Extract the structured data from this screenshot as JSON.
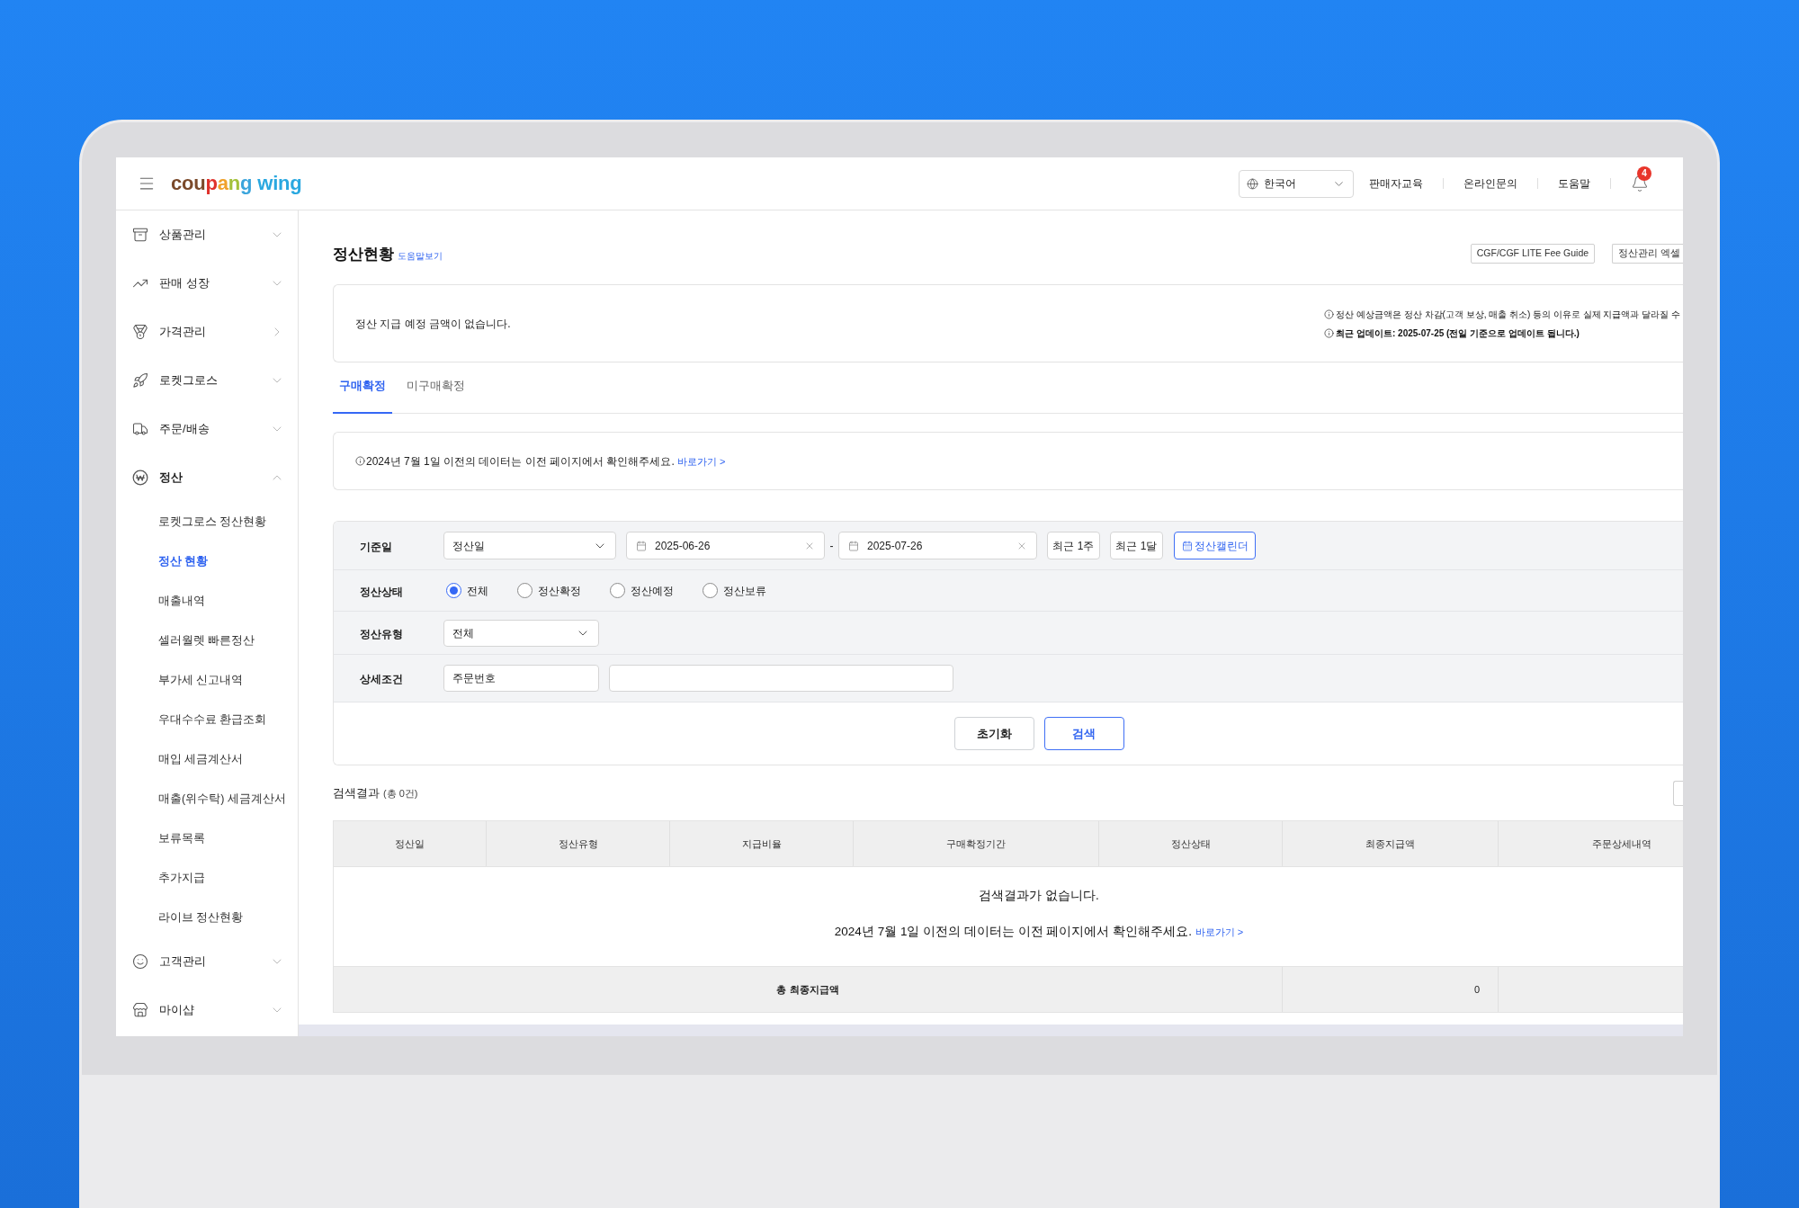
{
  "header": {
    "logo": {
      "parts": [
        {
          "text": "cou",
          "color": "#7b4a2b"
        },
        {
          "text": "p",
          "color": "#e0322c"
        },
        {
          "text": "a",
          "color": "#f0a12a"
        },
        {
          "text": "n",
          "color": "#a3c13a"
        },
        {
          "text": "g",
          "color": "#3ba5dc"
        },
        {
          "text": " wing",
          "color": "#2aa8e0"
        }
      ]
    },
    "language": "한국어",
    "links": [
      "판매자교육",
      "온라인문의",
      "도움말"
    ],
    "notification_count": "4"
  },
  "sidebar": {
    "items": [
      {
        "label": "상품관리",
        "kind": "group",
        "expanded": false
      },
      {
        "label": "판매 성장",
        "kind": "group",
        "expanded": false
      },
      {
        "label": "가격관리",
        "kind": "link"
      },
      {
        "label": "로켓그로스",
        "kind": "group",
        "expanded": false
      },
      {
        "label": "주문/배송",
        "kind": "group",
        "expanded": false
      },
      {
        "label": "정산",
        "kind": "group",
        "expanded": true,
        "children": [
          {
            "label": "로켓그로스 정산현황",
            "selected": false
          },
          {
            "label": "정산 현황",
            "selected": true
          },
          {
            "label": "매출내역",
            "selected": false
          },
          {
            "label": "셀러월렛 빠른정산",
            "selected": false
          },
          {
            "label": "부가세 신고내역",
            "selected": false
          },
          {
            "label": "우대수수료 환급조회",
            "selected": false
          },
          {
            "label": "매입 세금계산서",
            "selected": false
          },
          {
            "label": "매출(위수탁) 세금계산서",
            "selected": false
          },
          {
            "label": "보류목록",
            "selected": false
          },
          {
            "label": "추가지급",
            "selected": false
          },
          {
            "label": "라이브 정산현황",
            "selected": false
          }
        ]
      },
      {
        "label": "고객관리",
        "kind": "group",
        "expanded": false
      },
      {
        "label": "마이샵",
        "kind": "group",
        "expanded": false
      }
    ]
  },
  "page": {
    "title": "정산현황",
    "help_link": "도움말보기",
    "buttons": [
      "CGF/CGF LITE Fee Guide",
      "정산관리 엑셀"
    ]
  },
  "summary": {
    "message": "정산 지급 예정 금액이 없습니다.",
    "notes": [
      {
        "text": "정산 예상금액은 정산 차감(고객 보상, 매출 취소) 등의 이유로 실제 지급액과 달라질 수",
        "bold": false
      },
      {
        "text": "최근 업데이트: 2025-07-25 (전일 기준으로 업데이트 됩니다.)",
        "bold": true
      }
    ]
  },
  "tabs": [
    {
      "label": "구매확정",
      "selected": true
    },
    {
      "label": "미구매확정",
      "selected": false
    }
  ],
  "notice": {
    "text": "2024년 7월 1일 이전의 데이터는 이전 페이지에서 확인해주세요.",
    "link": "바로가기 >"
  },
  "filters": {
    "date": {
      "label": "기준일",
      "basis": "정산일",
      "start": "2025-06-26",
      "separator": "-",
      "end": "2025-07-26",
      "presets": [
        "최근 1주",
        "최근 1달"
      ],
      "calendar": "정산캘린더"
    },
    "status": {
      "label": "정산상태",
      "options": [
        {
          "label": "전체",
          "selected": true
        },
        {
          "label": "정산확정",
          "selected": false
        },
        {
          "label": "정산예정",
          "selected": false
        },
        {
          "label": "정산보류",
          "selected": false
        }
      ]
    },
    "type": {
      "label": "정산유형",
      "value": "전체"
    },
    "detail": {
      "label": "상세조건",
      "field": "주문번호"
    },
    "actions": [
      {
        "label": "초기화",
        "kind": "default"
      },
      {
        "label": "검색",
        "kind": "primary"
      }
    ]
  },
  "results": {
    "title": "검색결과",
    "count": "(총 0건)",
    "columns": [
      "정산일",
      "정산유형",
      "지급비율",
      "구매확정기간",
      "정산상태",
      "최종지급액",
      "주문상세내역"
    ],
    "empty_message": "검색결과가 없습니다.",
    "empty_note": {
      "text": "2024년 7월 1일 이전의 데이터는 이전 페이지에서 확인해주세요.",
      "link": "바로가기 >"
    },
    "total": {
      "label": "총 최종지급액",
      "value": "0"
    }
  }
}
